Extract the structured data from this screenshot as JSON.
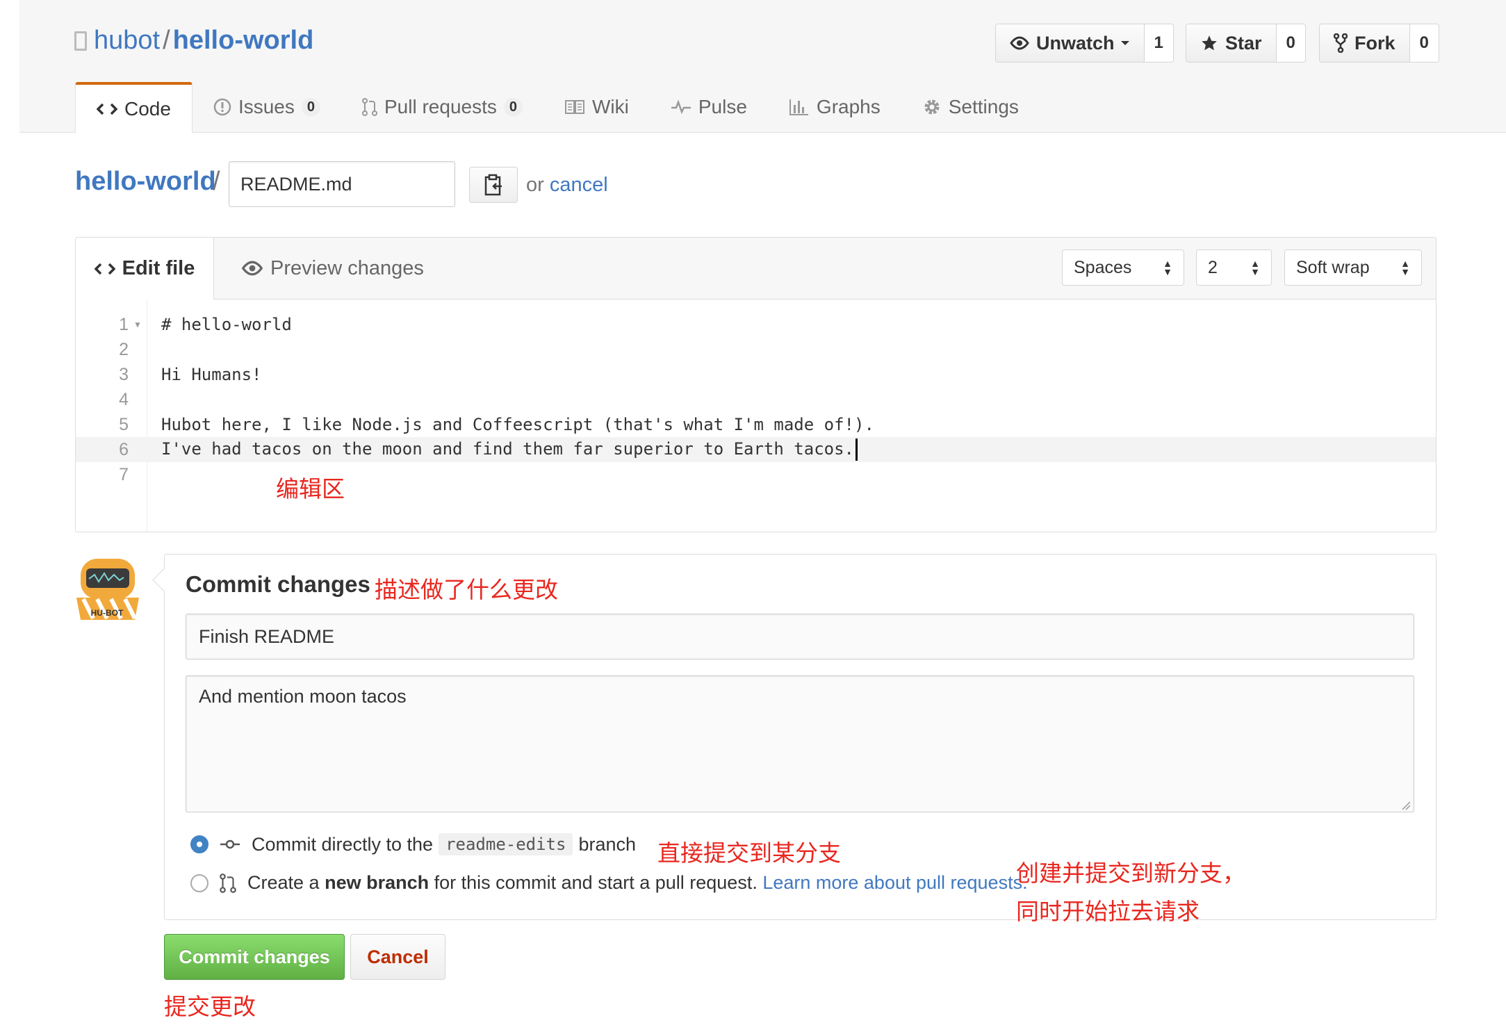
{
  "header": {
    "owner": "hubot",
    "separator": "/",
    "repo": "hello-world",
    "watch": {
      "label": "Unwatch",
      "count": "1"
    },
    "star": {
      "label": "Star",
      "count": "0"
    },
    "fork": {
      "label": "Fork",
      "count": "0"
    }
  },
  "tabs": [
    {
      "label": "Code",
      "icon": "code-icon"
    },
    {
      "label": "Issues",
      "badge": "0",
      "icon": "issue-icon"
    },
    {
      "label": "Pull requests",
      "badge": "0",
      "icon": "pull-request-icon"
    },
    {
      "label": "Wiki",
      "icon": "book-icon"
    },
    {
      "label": "Pulse",
      "icon": "pulse-icon"
    },
    {
      "label": "Graphs",
      "icon": "graph-icon"
    },
    {
      "label": "Settings",
      "icon": "gear-icon"
    }
  ],
  "breadcrumb": {
    "repo": "hello-world",
    "separator": "/",
    "filename": "README.md",
    "or_text": "or",
    "cancel_link": "cancel"
  },
  "editor": {
    "tab_edit": "Edit file",
    "tab_preview": "Preview changes",
    "indent_mode": "Spaces",
    "indent_size": "2",
    "wrap_mode": "Soft wrap",
    "lines": [
      {
        "num": "1",
        "text": "# hello-world"
      },
      {
        "num": "2",
        "text": ""
      },
      {
        "num": "3",
        "text": "Hi Humans!"
      },
      {
        "num": "4",
        "text": ""
      },
      {
        "num": "5",
        "text": "Hubot here, I like Node.js and Coffeescript (that's what I'm made of!)."
      },
      {
        "num": "6",
        "text": "I've had tacos on the moon and find them far superior to Earth tacos."
      },
      {
        "num": "7",
        "text": ""
      }
    ]
  },
  "commit": {
    "title": "Commit changes",
    "summary": "Finish README",
    "description": "And mention moon tacos",
    "option_direct": {
      "prefix": "Commit directly to the",
      "branch": "readme-edits",
      "suffix": "branch"
    },
    "option_new": {
      "prefix": "Create a",
      "bold": "new branch",
      "suffix": "for this commit and start a pull request.",
      "link": "Learn more about pull requests."
    },
    "submit_label": "Commit changes",
    "cancel_label": "Cancel",
    "avatar_text": "HU-BOT"
  },
  "annotations": {
    "edit_area": "编辑区",
    "describe_change": "描述做了什么更改",
    "commit_direct": "直接提交到某分支",
    "new_branch_line1": "创建并提交到新分支，",
    "new_branch_line2": "同时开始拉去请求",
    "submit": "提交更改"
  },
  "colors": {
    "link": "#4078c0",
    "tab_accent": "#d26911",
    "primary_button": "#60b044",
    "cancel_text": "#bd2c00",
    "annotation": "#e8271f",
    "radio_selected": "#4183c4"
  }
}
